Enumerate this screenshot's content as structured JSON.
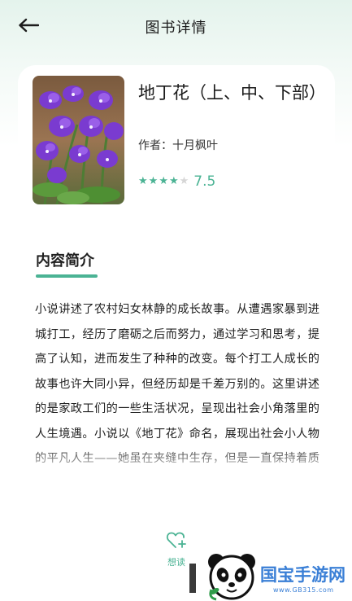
{
  "header": {
    "title": "图书详情",
    "back_icon": "arrow-left-icon"
  },
  "book": {
    "title": "地丁花（上、中、下部）",
    "author": "作者：十月枫叶",
    "rating_stars": 4,
    "rating_max": 5,
    "score": "7.5",
    "cover_icon": "violet-flowers-cover-image"
  },
  "intro": {
    "heading": "内容简介",
    "text": "小说讲述了农村妇女林静的成长故事。从遭遇家暴到进城打工，经历了磨砺之后而努力，通过学习和思考，提高了认知，进而发生了种种的改变。每个打工人成长的故事也许大同小异，但经历却是千差万别的。这里讲述的是家政工们的一些生活状况，呈现出社会小角落里的人生境遇。小说以《地丁花》命名，展现出社会小人物的平凡人生——她虽在夹缝中生存，但是一直保持着质朴的品质……"
  },
  "bottom": {
    "want_read_label": "想读",
    "want_read_icon": "heart-plus-icon"
  },
  "watermark": {
    "name": "国宝手游网",
    "url": "www.GB315.com",
    "logo_icon": "panda-logo"
  },
  "colors": {
    "accent": "#4bb394",
    "watermark_blue": "#3a7fd6"
  }
}
